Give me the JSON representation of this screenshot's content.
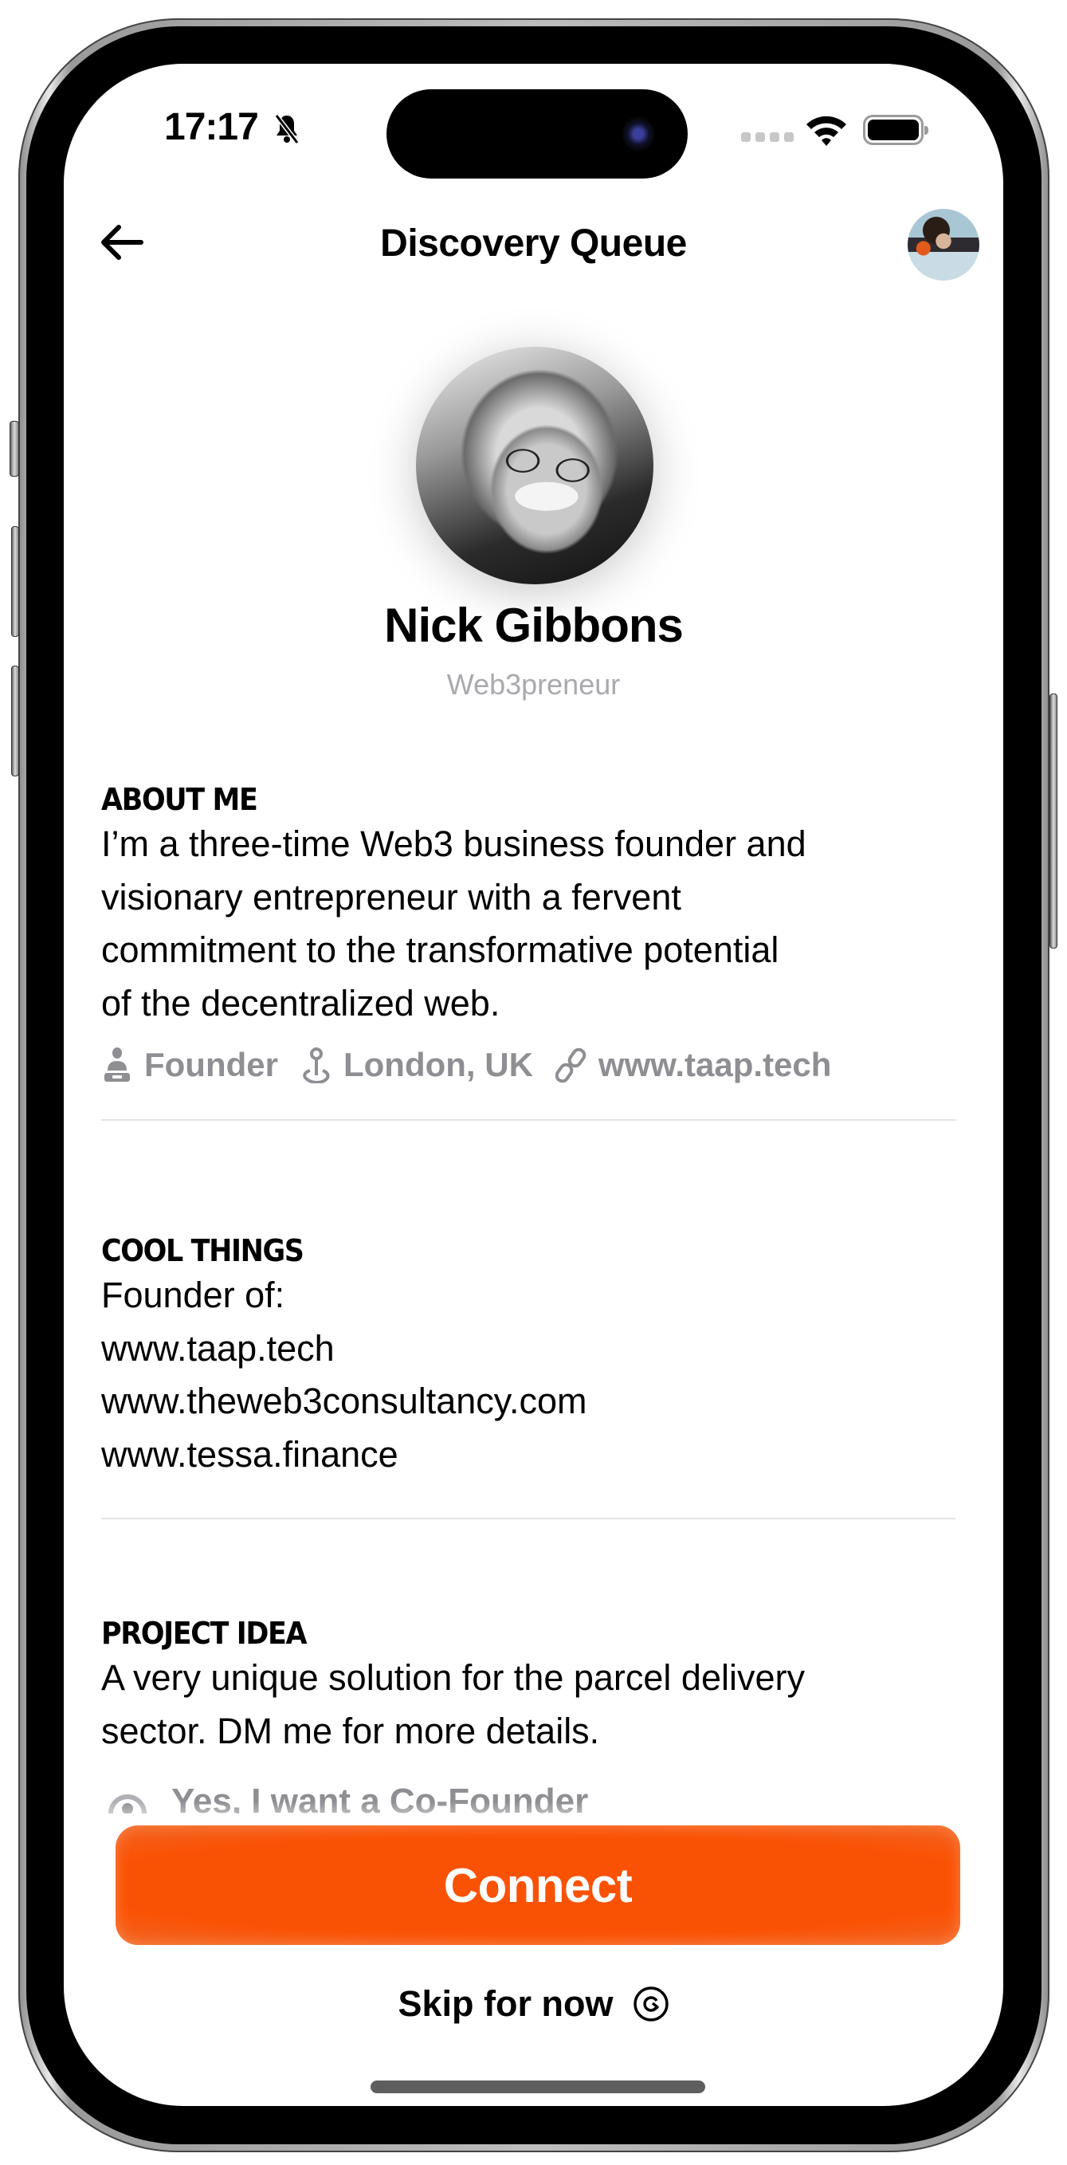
{
  "status_bar": {
    "time": "17:17",
    "silent_mode_icon": "bell-slash-icon",
    "signal_icon": "cellular-signal-icon",
    "wifi_icon": "wifi-icon",
    "battery_icon": "battery-full-icon"
  },
  "nav": {
    "back_icon": "arrow-left-icon",
    "title": "Discovery Queue",
    "avatar_icon": "user-avatar"
  },
  "profile": {
    "name": "Nick Gibbons",
    "subtitle": "Web3preneur"
  },
  "sections": {
    "about": {
      "heading": "ABOUT ME",
      "lines": [
        "I’m a three-time Web3 business founder and",
        "visionary entrepreneur with a fervent",
        "commitment to the transformative potential",
        "of the decentralized web."
      ],
      "meta": [
        {
          "icon": "person-icon",
          "label": "Founder"
        },
        {
          "icon": "location-pin-icon",
          "label": "London, UK"
        },
        {
          "icon": "link-icon",
          "label": "www.taap.tech"
        }
      ]
    },
    "cool_things": {
      "heading": "COOL THINGS",
      "lines": [
        "Founder of:",
        "www.taap.tech",
        "www.theweb3consultancy.com",
        "www.tessa.finance"
      ]
    },
    "project_idea": {
      "heading": "PROJECT IDEA",
      "lines": [
        "A very unique solution for the parcel delivery",
        "sector. DM me for more details."
      ],
      "cofounder_icon": "cofounder-icon",
      "cofounder_label": "Yes, I want a Co-Founder"
    }
  },
  "actions": {
    "connect_label": "Connect",
    "skip_label": "Skip for now",
    "skip_icon": "skip-arrow-circle-icon"
  },
  "colors": {
    "accent": "#FA5205",
    "muted_text": "#8E8E93",
    "subtitle_text": "#A9A9AE"
  }
}
